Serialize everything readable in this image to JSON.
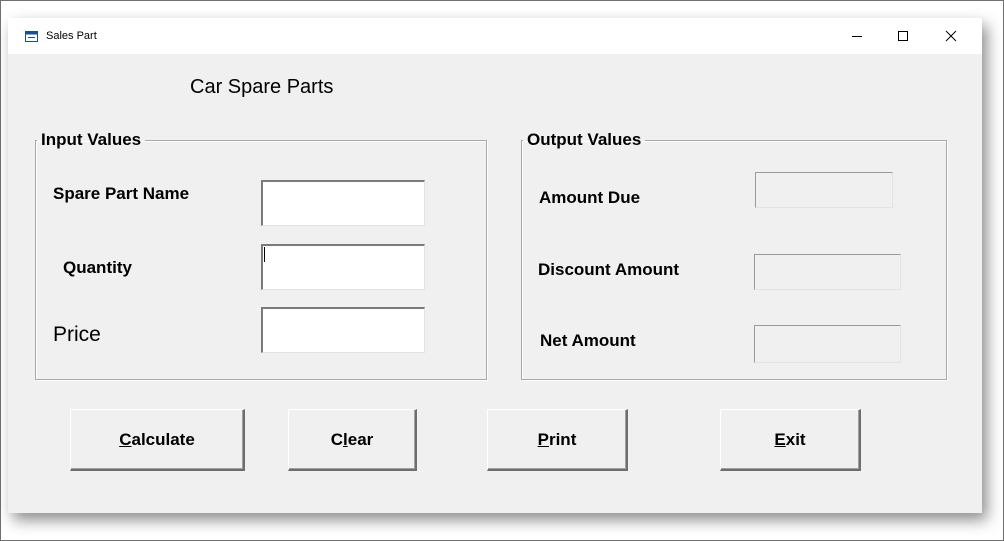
{
  "window": {
    "title": "Sales Part",
    "controls": {
      "minimize": "minimize",
      "maximize": "maximize",
      "close": "close"
    }
  },
  "form": {
    "heading": "Car Spare Parts",
    "input_group": {
      "legend": "Input Values",
      "spare_part_name_label": "Spare Part Name",
      "spare_part_name_value": "",
      "quantity_label": "Quantity",
      "quantity_value": "",
      "price_label": "Price",
      "price_value": ""
    },
    "output_group": {
      "legend": "Output Values",
      "amount_due_label": "Amount Due",
      "amount_due_value": "",
      "discount_amount_label": "Discount Amount",
      "discount_amount_value": "",
      "net_amount_label": "Net Amount",
      "net_amount_value": ""
    }
  },
  "buttons": {
    "calculate": {
      "mnemonic": "C",
      "rest": "alculate"
    },
    "clear": {
      "pre": "C",
      "mnemonic": "l",
      "rest": "ear"
    },
    "print": {
      "mnemonic": "P",
      "rest": "rint"
    },
    "exit": {
      "mnemonic": "E",
      "rest": "xit"
    }
  },
  "colors": {
    "form_background": "#f0f0f0",
    "titlebar_background": "#ffffff",
    "text": "#000000",
    "group_border": "#a8a8a8"
  },
  "icons": [
    "app-icon",
    "minimize-icon",
    "maximize-icon",
    "close-icon"
  ]
}
